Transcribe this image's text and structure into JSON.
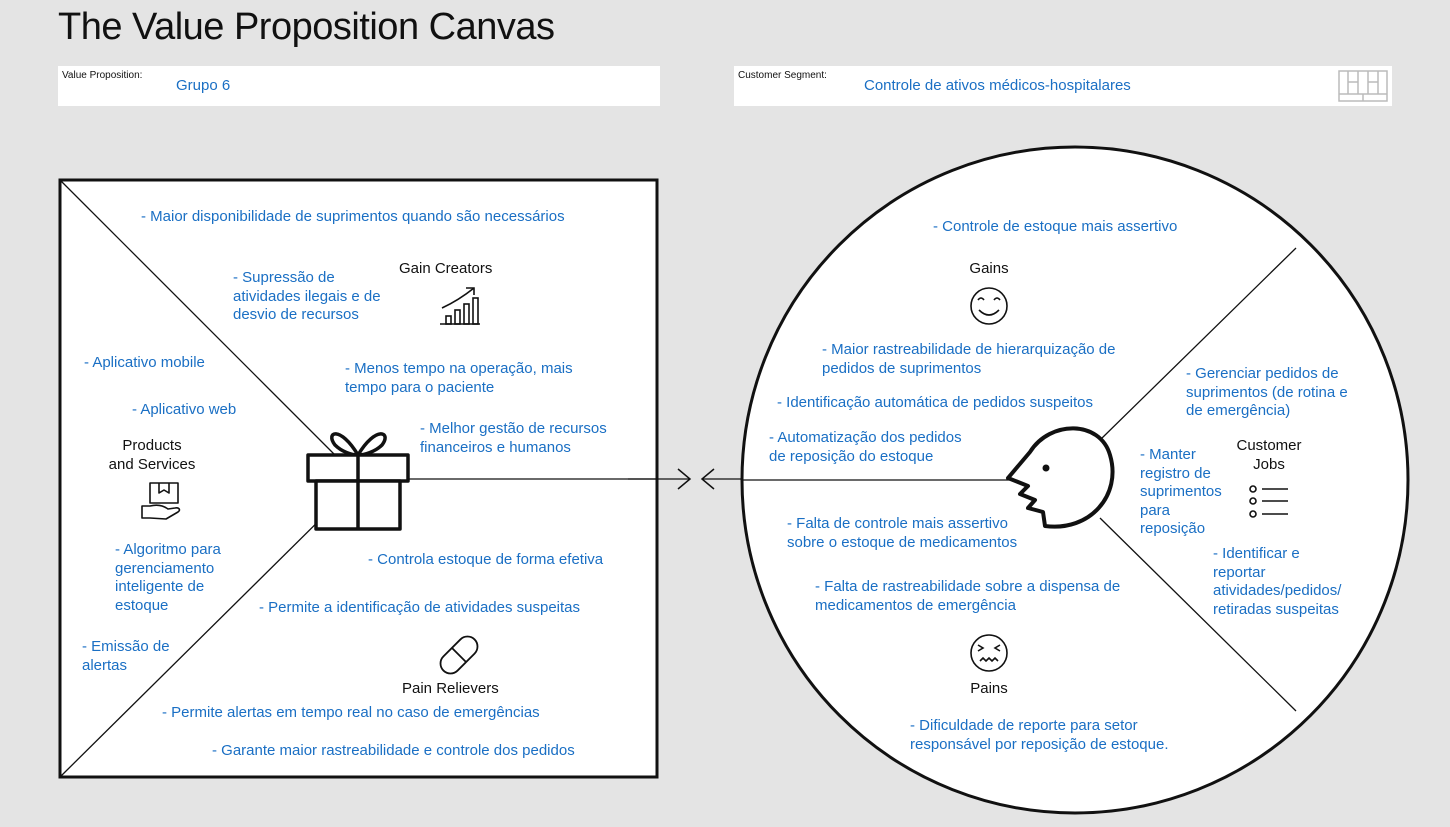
{
  "title": "The Value Proposition Canvas",
  "value_proposition": {
    "label": "Value Proposition:",
    "value": "Grupo 6"
  },
  "customer_segment": {
    "label": "Customer Segment:",
    "value": "Controle de ativos médicos-hospitalares"
  },
  "square": {
    "gain_creators": {
      "heading": "Gain Creators",
      "icon": "chart-growth-icon",
      "notes": [
        "- Maior disponibilidade de suprimentos quando são necessários",
        "- Supressão de\natividades ilegais e de\ndesvio de recursos",
        "- Menos tempo na operação, mais\ntempo para o paciente",
        "- Melhor gestão de recursos\nfinanceiros e humanos"
      ]
    },
    "products_services": {
      "heading": "Products\nand Services",
      "icon": "box-in-hand-icon",
      "notes": [
        "- Aplicativo mobile",
        "- Aplicativo web",
        "- Algoritmo para\ngerenciamento\ninteligente de\nestoque",
        "- Emissão de\nalertas"
      ]
    },
    "pain_relievers": {
      "heading": "Pain Relievers",
      "icon": "pill-icon",
      "notes": [
        "- Controla estoque de forma efetiva",
        "- Permite a identificação de atividades suspeitas",
        "- Permite alertas em tempo real no caso de emergências",
        "- Garante maior rastreabilidade e controle dos pedidos"
      ]
    },
    "center_icon": "gift-icon"
  },
  "circle": {
    "gains": {
      "heading": "Gains",
      "icon": "smile-icon",
      "notes": [
        "- Controle de estoque mais assertivo",
        "- Maior rastreabilidade de hierarquização de\npedidos de suprimentos",
        "- Identificação automática de pedidos suspeitos",
        "- Automatização dos pedidos\nde reposição do estoque"
      ]
    },
    "customer_jobs": {
      "heading": "Customer\nJobs",
      "icon": "list-icon",
      "notes": [
        "- Gerenciar pedidos de\nsuprimentos (de rotina e\nde emergência)",
        "- Manter\nregistro de\nsuprimentos\n para\nreposição",
        "- Identificar e\nreportar\natividades/pedidos/\nretiradas suspeitas"
      ]
    },
    "pains": {
      "heading": "Pains",
      "icon": "sick-face-icon",
      "notes": [
        "- Falta de controle mais assertivo\nsobre o estoque de medicamentos",
        "- Falta de rastreabilidade sobre a dispensa de\nmedicamentos de emergência",
        "- Dificuldade de reporte para setor\nresponsável por reposição de estoque."
      ]
    },
    "center_icon": "face-profile-icon"
  },
  "colors": {
    "note_text": "#1a6fc4",
    "background": "#e4e4e4",
    "line": "#111111"
  }
}
